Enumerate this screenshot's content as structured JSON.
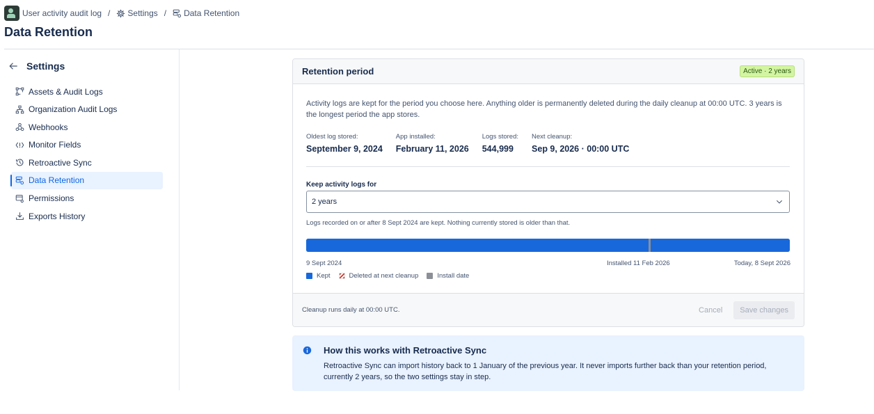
{
  "breadcrumb": {
    "app": "User activity audit log",
    "separator": "/",
    "settings": "Settings",
    "current": "Data Retention"
  },
  "page_title": "Data Retention",
  "sidebar": {
    "title": "Settings",
    "back_icon": "arrow-left-icon",
    "items": [
      {
        "label": "Assets & Audit Logs",
        "icon": "assets-icon",
        "active": false
      },
      {
        "label": "Organization Audit Logs",
        "icon": "org-chart-icon",
        "active": false
      },
      {
        "label": "Webhooks",
        "icon": "webhook-icon",
        "active": false
      },
      {
        "label": "Monitor Fields",
        "icon": "code-brackets-icon",
        "active": false
      },
      {
        "label": "Retroactive Sync",
        "icon": "history-icon",
        "active": false
      },
      {
        "label": "Data Retention",
        "icon": "database-settings-icon",
        "active": true
      },
      {
        "label": "Permissions",
        "icon": "permissions-icon",
        "active": false
      },
      {
        "label": "Exports History",
        "icon": "download-icon",
        "active": false
      }
    ]
  },
  "retention": {
    "title": "Retention period",
    "badge": "Active · 2 years",
    "description": "Activity logs are kept for the period you choose here. Anything older is permanently deleted during the daily cleanup at 00:00 UTC. 3 years is the longest period the app stores.",
    "stats": [
      {
        "label": "Oldest log stored:",
        "value": "September 9, 2024"
      },
      {
        "label": "App installed:",
        "value": "February 11, 2026"
      },
      {
        "label": "Logs stored:",
        "value": "544,999"
      },
      {
        "label": "Next cleanup:",
        "value": "Sep 9, 2026 · 00:00 UTC"
      }
    ],
    "field_label": "Keep activity logs for",
    "selected": "2 years",
    "hint": "Logs recorded on or after 8 Sept 2024 are kept. Nothing currently stored is older than that.",
    "timeline": {
      "start_label": "9 Sept 2024",
      "install_label": "Installed 11 Feb 2026",
      "end_label": "Today, 8 Sept 2026",
      "kept_fraction": 1.0,
      "install_fraction": 0.71
    },
    "legend": {
      "kept": "Kept",
      "deleted": "Deleted at next cleanup",
      "install": "Install date"
    },
    "colors": {
      "kept": "#1868db",
      "deleted": "#c9372c",
      "install": "#8c8f97"
    },
    "footer_note": "Cleanup runs daily at 00:00 UTC.",
    "cancel_label": "Cancel",
    "save_label": "Save changes"
  },
  "info": {
    "title": "How this works with Retroactive Sync",
    "body": "Retroactive Sync can import history back to 1 January of the previous year. It never imports further back than your retention period, currently 2 years, so the two settings stay in step."
  }
}
